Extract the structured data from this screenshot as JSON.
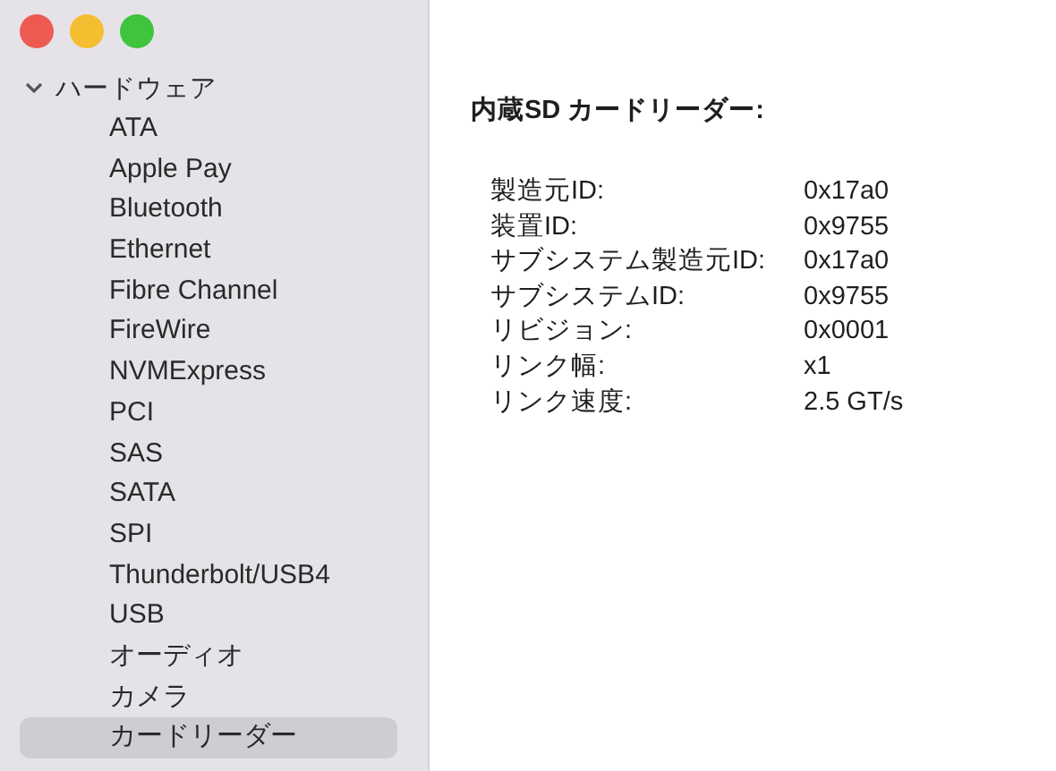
{
  "sidebar": {
    "group": {
      "label": "ハードウェア",
      "expanded": true,
      "children": [
        {
          "label": "ATA",
          "selected": false
        },
        {
          "label": "Apple Pay",
          "selected": false
        },
        {
          "label": "Bluetooth",
          "selected": false
        },
        {
          "label": "Ethernet",
          "selected": false
        },
        {
          "label": "Fibre Channel",
          "selected": false
        },
        {
          "label": "FireWire",
          "selected": false
        },
        {
          "label": "NVMExpress",
          "selected": false
        },
        {
          "label": "PCI",
          "selected": false
        },
        {
          "label": "SAS",
          "selected": false
        },
        {
          "label": "SATA",
          "selected": false
        },
        {
          "label": "SPI",
          "selected": false
        },
        {
          "label": "Thunderbolt/USB4",
          "selected": false
        },
        {
          "label": "USB",
          "selected": false
        },
        {
          "label": "オーディオ",
          "selected": false
        },
        {
          "label": "カメラ",
          "selected": false
        },
        {
          "label": "カードリーダー",
          "selected": true
        }
      ]
    }
  },
  "detail": {
    "title": "内蔵SD カードリーダー:",
    "properties": [
      {
        "label": "製造元ID:",
        "value": "0x17a0"
      },
      {
        "label": "装置ID:",
        "value": "0x9755"
      },
      {
        "label": "サブシステム製造元ID:",
        "value": "0x17a0"
      },
      {
        "label": "サブシステムID:",
        "value": "0x9755"
      },
      {
        "label": "リビジョン:",
        "value": "0x0001"
      },
      {
        "label": "リンク幅:",
        "value": "x1"
      },
      {
        "label": "リンク速度:",
        "value": "2.5 GT/s"
      }
    ]
  }
}
